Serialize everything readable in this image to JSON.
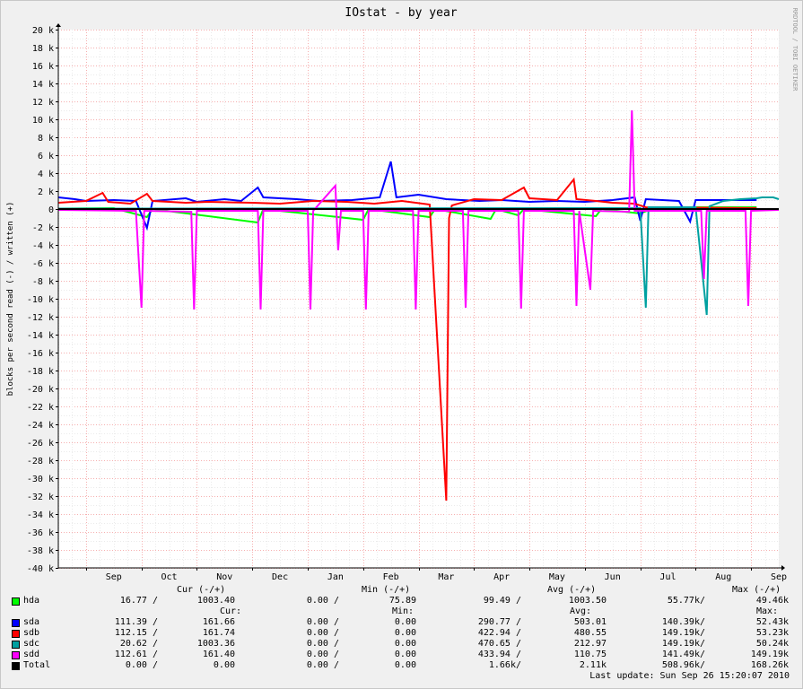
{
  "chart_data": {
    "type": "line",
    "title": "IOstat - by year",
    "ylabel": "blocks per second read (-) / written (+)",
    "watermark": "RRDTOOL / TOBI OETIKER",
    "ylim": [
      -40000,
      20000
    ],
    "yticks": [
      {
        "v": 20000,
        "label": "20 k"
      },
      {
        "v": 18000,
        "label": "18 k"
      },
      {
        "v": 16000,
        "label": "16 k"
      },
      {
        "v": 14000,
        "label": "14 k"
      },
      {
        "v": 12000,
        "label": "12 k"
      },
      {
        "v": 10000,
        "label": "10 k"
      },
      {
        "v": 8000,
        "label": "8 k"
      },
      {
        "v": 6000,
        "label": "6 k"
      },
      {
        "v": 4000,
        "label": "4 k"
      },
      {
        "v": 2000,
        "label": "2 k"
      },
      {
        "v": 0,
        "label": "0"
      },
      {
        "v": -2000,
        "label": "-2 k"
      },
      {
        "v": -4000,
        "label": "-4 k"
      },
      {
        "v": -6000,
        "label": "-6 k"
      },
      {
        "v": -8000,
        "label": "-8 k"
      },
      {
        "v": -10000,
        "label": "-10 k"
      },
      {
        "v": -12000,
        "label": "-12 k"
      },
      {
        "v": -14000,
        "label": "-14 k"
      },
      {
        "v": -16000,
        "label": "-16 k"
      },
      {
        "v": -18000,
        "label": "-18 k"
      },
      {
        "v": -20000,
        "label": "-20 k"
      },
      {
        "v": -22000,
        "label": "-22 k"
      },
      {
        "v": -24000,
        "label": "-24 k"
      },
      {
        "v": -26000,
        "label": "-26 k"
      },
      {
        "v": -28000,
        "label": "-28 k"
      },
      {
        "v": -30000,
        "label": "-30 k"
      },
      {
        "v": -32000,
        "label": "-32 k"
      },
      {
        "v": -34000,
        "label": "-34 k"
      },
      {
        "v": -36000,
        "label": "-36 k"
      },
      {
        "v": -38000,
        "label": "-38 k"
      },
      {
        "v": -40000,
        "label": "-40 k"
      }
    ],
    "x_months": [
      "Sep",
      "Oct",
      "Nov",
      "Dec",
      "Jan",
      "Feb",
      "Mar",
      "Apr",
      "May",
      "Jun",
      "Jul",
      "Aug",
      "Sep"
    ],
    "x_range_months": [
      0,
      13
    ],
    "series": [
      {
        "name": "hda",
        "color": "#00ff00",
        "points": [
          [
            0,
            0.05
          ],
          [
            1,
            0.1
          ],
          [
            1.6,
            -0.9
          ],
          [
            1.7,
            0
          ],
          [
            3.6,
            -1.5
          ],
          [
            3.7,
            0
          ],
          [
            5.5,
            -1.2
          ],
          [
            5.6,
            0
          ],
          [
            6.7,
            -0.9
          ],
          [
            6.8,
            0
          ],
          [
            7.8,
            -1.1
          ],
          [
            7.9,
            0
          ],
          [
            8.3,
            -0.7
          ],
          [
            8.4,
            0
          ],
          [
            9.7,
            -0.8
          ],
          [
            9.8,
            0
          ],
          [
            10.5,
            -0.5
          ],
          [
            10.7,
            0
          ],
          [
            11.5,
            0.2
          ],
          [
            12.6,
            0.2
          ]
        ]
      },
      {
        "name": "sda",
        "color": "#0000ff",
        "points": [
          [
            0,
            1.3
          ],
          [
            0.3,
            1.1
          ],
          [
            0.5,
            0.9
          ],
          [
            1.0,
            1.0
          ],
          [
            1.4,
            0.9
          ],
          [
            1.6,
            -2.1
          ],
          [
            1.7,
            0.9
          ],
          [
            2.3,
            1.2
          ],
          [
            2.5,
            0.8
          ],
          [
            3.0,
            1.1
          ],
          [
            3.3,
            0.9
          ],
          [
            3.6,
            2.4
          ],
          [
            3.7,
            1.3
          ],
          [
            4.3,
            1.1
          ],
          [
            4.7,
            0.9
          ],
          [
            5.3,
            1.0
          ],
          [
            5.8,
            1.3
          ],
          [
            6.0,
            5.3
          ],
          [
            6.1,
            1.3
          ],
          [
            6.5,
            1.6
          ],
          [
            7.0,
            1.1
          ],
          [
            7.6,
            0.9
          ],
          [
            8.0,
            1.0
          ],
          [
            8.5,
            0.8
          ],
          [
            9.0,
            0.9
          ],
          [
            9.5,
            0.8
          ],
          [
            10.0,
            1.0
          ],
          [
            10.4,
            1.3
          ],
          [
            10.5,
            -1.3
          ],
          [
            10.6,
            1.1
          ],
          [
            11.2,
            0.9
          ],
          [
            11.4,
            -1.4
          ],
          [
            11.5,
            1.0
          ],
          [
            12.6,
            1.0
          ]
        ]
      },
      {
        "name": "sdb",
        "color": "#ff0000",
        "points": [
          [
            0,
            0.7
          ],
          [
            0.5,
            0.9
          ],
          [
            0.8,
            1.8
          ],
          [
            0.9,
            0.8
          ],
          [
            1.3,
            0.6
          ],
          [
            1.6,
            1.7
          ],
          [
            1.7,
            0.9
          ],
          [
            2.3,
            0.7
          ],
          [
            2.7,
            0.8
          ],
          [
            3.5,
            0.7
          ],
          [
            4.0,
            0.6
          ],
          [
            4.6,
            0.9
          ],
          [
            5.2,
            0.8
          ],
          [
            5.7,
            0.6
          ],
          [
            6.2,
            0.9
          ],
          [
            6.7,
            0.5
          ],
          [
            7.0,
            -32.5
          ],
          [
            7.05,
            -1.0
          ],
          [
            7.1,
            0.4
          ],
          [
            7.5,
            1.1
          ],
          [
            8.0,
            1.0
          ],
          [
            8.4,
            2.4
          ],
          [
            8.5,
            1.2
          ],
          [
            9.0,
            1.0
          ],
          [
            9.3,
            3.3
          ],
          [
            9.35,
            1.1
          ],
          [
            9.7,
            0.9
          ],
          [
            10.0,
            0.7
          ],
          [
            10.4,
            0.6
          ],
          [
            10.6,
            0.2
          ],
          [
            12.6,
            0.1
          ]
        ]
      },
      {
        "name": "sdc",
        "color": "#00a0a0",
        "points": [
          [
            0,
            0.05
          ],
          [
            10.5,
            0.1
          ],
          [
            10.6,
            -11.0
          ],
          [
            10.65,
            0.2
          ],
          [
            11.5,
            0.2
          ],
          [
            11.7,
            -11.8
          ],
          [
            11.75,
            0.3
          ],
          [
            12.0,
            0.9
          ],
          [
            12.3,
            1.1
          ],
          [
            12.6,
            1.2
          ],
          [
            12.7,
            1.3
          ],
          [
            12.9,
            1.3
          ],
          [
            13,
            1.1
          ]
        ]
      },
      {
        "name": "sdd",
        "color": "#ff00ff",
        "points": [
          [
            0,
            -0.1
          ],
          [
            1.4,
            -0.2
          ],
          [
            1.5,
            -11.0
          ],
          [
            1.55,
            -0.2
          ],
          [
            2.4,
            -0.3
          ],
          [
            2.45,
            -11.2
          ],
          [
            2.5,
            -0.2
          ],
          [
            3.6,
            -0.2
          ],
          [
            3.65,
            -11.2
          ],
          [
            3.7,
            -0.2
          ],
          [
            4.5,
            -0.2
          ],
          [
            4.55,
            -11.2
          ],
          [
            4.6,
            -0.2
          ],
          [
            5.0,
            2.6
          ],
          [
            5.05,
            -4.6
          ],
          [
            5.1,
            -0.2
          ],
          [
            5.5,
            -0.2
          ],
          [
            5.55,
            -11.2
          ],
          [
            5.6,
            -0.2
          ],
          [
            6.4,
            -0.2
          ],
          [
            6.45,
            -11.2
          ],
          [
            6.5,
            -0.2
          ],
          [
            7.3,
            -0.2
          ],
          [
            7.35,
            -11.0
          ],
          [
            7.4,
            -0.2
          ],
          [
            8.3,
            -0.2
          ],
          [
            8.35,
            -11.1
          ],
          [
            8.4,
            -0.2
          ],
          [
            9.3,
            -0.2
          ],
          [
            9.35,
            -10.8
          ],
          [
            9.4,
            -0.2
          ],
          [
            9.6,
            -9.0
          ],
          [
            9.65,
            -0.2
          ],
          [
            10.3,
            -0.3
          ],
          [
            10.35,
            11.0
          ],
          [
            10.4,
            -0.2
          ],
          [
            11.6,
            -0.2
          ],
          [
            11.65,
            -7.8
          ],
          [
            11.7,
            -0.2
          ],
          [
            12.4,
            -0.2
          ],
          [
            12.45,
            -10.8
          ],
          [
            12.5,
            -0.2
          ],
          [
            13,
            -0.1
          ]
        ]
      },
      {
        "name": "Total",
        "color": "#000000",
        "points": [
          [
            0,
            0.0
          ],
          [
            13,
            0.0
          ]
        ]
      }
    ]
  },
  "legend": {
    "header": {
      "cur": "Cur (-/+)",
      "min": "Min (-/+)",
      "avg": "Avg (-/+)",
      "max": "Max (-/+)"
    },
    "header2": {
      "cur": "Cur:",
      "min": "Min:",
      "avg": "Avg:",
      "max": "Max:"
    },
    "rows": [
      {
        "name": "hda",
        "color": "#00ff00",
        "cur_r": "16.77 /",
        "cur_w": "1003.40",
        "min_r": "0.00 /",
        "min_w": "75.89",
        "avg_r": "99.49 /",
        "avg_w": "1003.50",
        "max_r": "55.77k/",
        "max_w": "49.46k"
      },
      {
        "name": "sda",
        "color": "#0000ff",
        "cur_r": "111.39 /",
        "cur_w": "161.66",
        "min_r": "0.00 /",
        "min_w": "0.00",
        "avg_r": "290.77 /",
        "avg_w": "503.01",
        "max_r": "140.39k/",
        "max_w": "52.43k"
      },
      {
        "name": "sdb",
        "color": "#ff0000",
        "cur_r": "112.15 /",
        "cur_w": "161.74",
        "min_r": "0.00 /",
        "min_w": "0.00",
        "avg_r": "422.94 /",
        "avg_w": "480.55",
        "max_r": "149.19k/",
        "max_w": "53.23k"
      },
      {
        "name": "sdc",
        "color": "#00a0a0",
        "cur_r": "20.62 /",
        "cur_w": "1003.36",
        "min_r": "0.00 /",
        "min_w": "0.00",
        "avg_r": "470.65 /",
        "avg_w": "212.97",
        "max_r": "149.19k/",
        "max_w": "50.24k"
      },
      {
        "name": "sdd",
        "color": "#ff00ff",
        "cur_r": "112.61 /",
        "cur_w": "161.40",
        "min_r": "0.00 /",
        "min_w": "0.00",
        "avg_r": "433.94 /",
        "avg_w": "110.75",
        "max_r": "141.49k/",
        "max_w": "149.19k"
      },
      {
        "name": "Total",
        "color": "#000000",
        "cur_r": "0.00 /",
        "cur_w": "0.00",
        "min_r": "0.00 /",
        "min_w": "0.00",
        "avg_r": "1.66k/",
        "avg_w": "2.11k",
        "max_r": "508.96k/",
        "max_w": "168.26k"
      }
    ],
    "last_update": "Last update: Sun Sep 26 15:20:07 2010"
  }
}
